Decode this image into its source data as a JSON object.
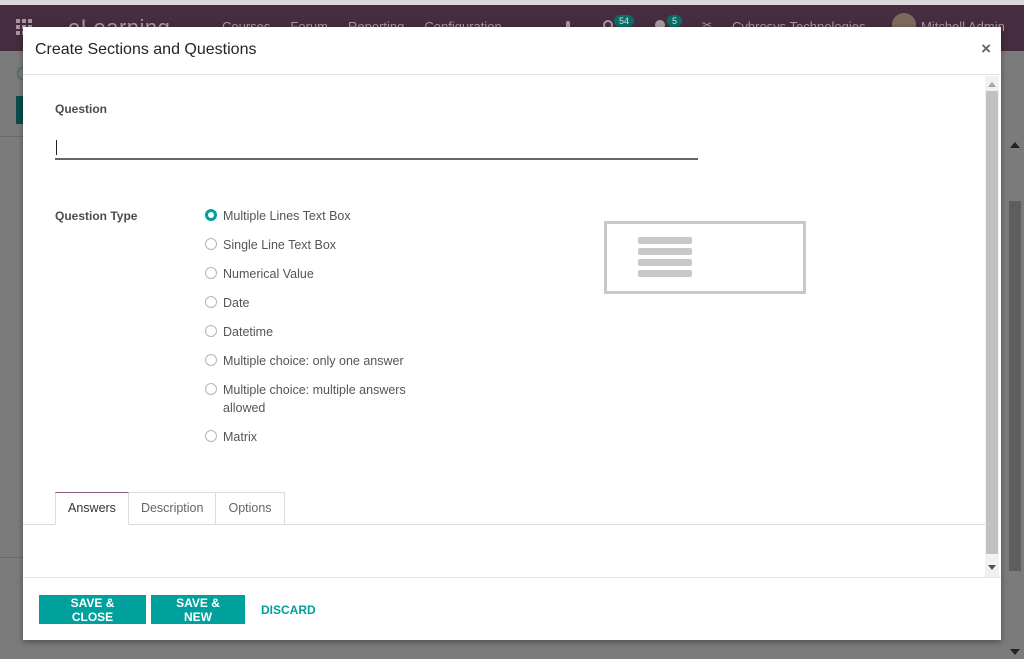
{
  "navbar": {
    "brand": "eLearning",
    "menu": [
      "Courses",
      "Forum",
      "Reporting",
      "Configuration"
    ],
    "activity_badge": "54",
    "messages_badge": "5",
    "company": "Cybrosys Technologies",
    "user": "Mitchell Admin"
  },
  "background": {
    "breadcrumb_initial": "C"
  },
  "modal": {
    "title": "Create Sections and Questions",
    "close_glyph": "×",
    "question": {
      "label": "Question",
      "value": "",
      "placeholder": ""
    },
    "question_type": {
      "label": "Question Type",
      "selected": "Multiple Lines Text Box",
      "options": [
        {
          "label": "Multiple Lines Text Box",
          "checked": true
        },
        {
          "label": "Single Line Text Box",
          "checked": false
        },
        {
          "label": "Numerical Value",
          "checked": false
        },
        {
          "label": "Date",
          "checked": false
        },
        {
          "label": "Datetime",
          "checked": false
        },
        {
          "label": "Multiple choice: only one answer",
          "checked": false
        },
        {
          "label": "Multiple choice: multiple answers allowed",
          "checked": false
        },
        {
          "label": "Matrix",
          "checked": false
        }
      ],
      "preview_icon": "multiline-text-preview-icon"
    },
    "tabs": [
      {
        "label": "Answers",
        "active": true
      },
      {
        "label": "Description",
        "active": false
      },
      {
        "label": "Options",
        "active": false
      }
    ],
    "footer": {
      "save_close": "SAVE & CLOSE",
      "save_new": "SAVE & NEW",
      "discard": "DISCARD"
    }
  },
  "colors": {
    "accent": "#00a09d",
    "navbar": "#452c3f",
    "tab_active_border": "#875a7b"
  }
}
